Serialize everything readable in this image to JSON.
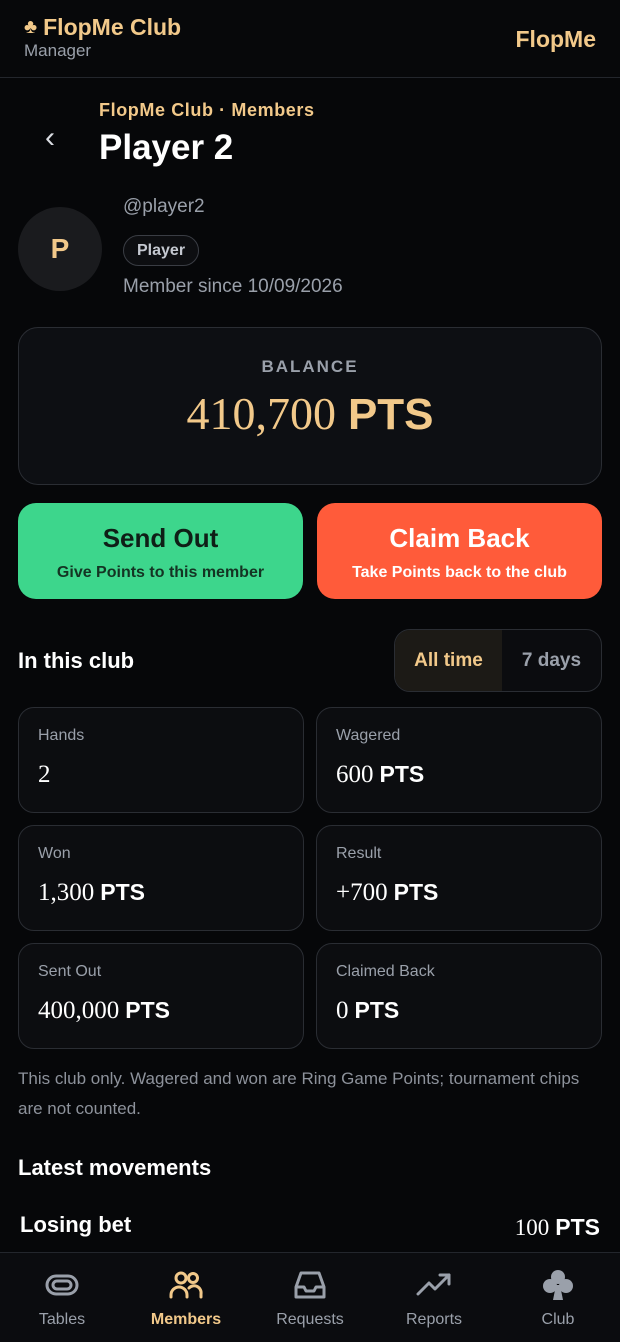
{
  "header": {
    "club_name": "FlopMe Club",
    "club_role": "Manager",
    "brand": "FlopMe"
  },
  "nav": {
    "back_glyph": "‹",
    "breadcrumb": "FlopMe Club · Members",
    "title": "Player 2"
  },
  "member": {
    "avatar_initial": "P",
    "handle": "@player2",
    "role": "Player",
    "since": "Member since 10/09/2026"
  },
  "balance": {
    "label": "BALANCE",
    "value": "410,700",
    "unit": "PTS"
  },
  "actions": {
    "send_out": {
      "label": "Send Out",
      "sub": "Give Points to this member"
    },
    "claim_back": {
      "label": "Claim Back",
      "sub": "Take Points back to the club"
    }
  },
  "stats_section": {
    "title": "In this club",
    "ranges": [
      "All time",
      "7 days"
    ],
    "active_range": "All time"
  },
  "stats": [
    {
      "label": "Hands",
      "value": "2",
      "unit": ""
    },
    {
      "label": "Wagered",
      "value": "600",
      "unit": "PTS"
    },
    {
      "label": "Won",
      "value": "1,300",
      "unit": "PTS"
    },
    {
      "label": "Result",
      "value": "+700",
      "unit": "PTS"
    },
    {
      "label": "Sent Out",
      "value": "400,000",
      "unit": "PTS"
    },
    {
      "label": "Claimed Back",
      "value": "0",
      "unit": "PTS"
    }
  ],
  "note": "This club only. Wagered and won are Ring Game Points; tournament chips are not counted.",
  "movements": {
    "title": "Latest movements",
    "items": [
      {
        "kind": "Losing bet",
        "amount": "100",
        "unit": "PTS"
      }
    ]
  },
  "bottom_nav": [
    {
      "label": "Tables",
      "icon": "tables-icon",
      "active": false
    },
    {
      "label": "Members",
      "icon": "members-icon",
      "active": true
    },
    {
      "label": "Requests",
      "icon": "inbox-icon",
      "active": false
    },
    {
      "label": "Reports",
      "icon": "trend-icon",
      "active": false
    },
    {
      "label": "Club",
      "icon": "club-suit-icon",
      "active": false
    }
  ],
  "colors": {
    "accent_gold": "#f2c98a",
    "send_green": "#3dd68c",
    "claim_orange": "#ff5b3a",
    "background": "#060709"
  }
}
